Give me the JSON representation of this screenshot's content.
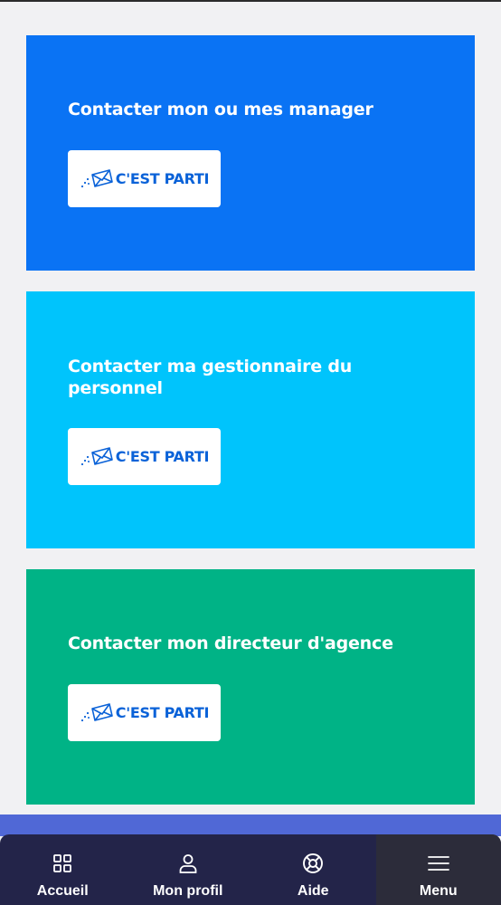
{
  "cards": [
    {
      "title": "Contacter mon ou mes manager",
      "button_label": "C'EST PARTI",
      "button_icon": "envelope-send-icon",
      "color": "#0a73f4"
    },
    {
      "title": "Contacter ma gestionnaire du personnel",
      "button_label": "C'EST PARTI",
      "button_icon": "envelope-send-icon",
      "color": "#00c4fc"
    },
    {
      "title": "Contacter mon directeur d'agence",
      "button_label": "C'EST PARTI",
      "button_icon": "envelope-send-icon",
      "color": "#00b386"
    }
  ],
  "bottom_nav": {
    "items": [
      {
        "label": "Accueil",
        "icon": "grid-icon"
      },
      {
        "label": "Mon profil",
        "icon": "user-icon"
      },
      {
        "label": "Aide",
        "icon": "lifebuoy-icon"
      },
      {
        "label": "Menu",
        "icon": "hamburger-menu-icon",
        "active": true
      }
    ],
    "background": "#232449",
    "active_background": "#2c2c3a"
  },
  "colors": {
    "page_background": "#f1f1f3",
    "accent_band": "#5068d6",
    "button_text": "#0a62d8"
  }
}
